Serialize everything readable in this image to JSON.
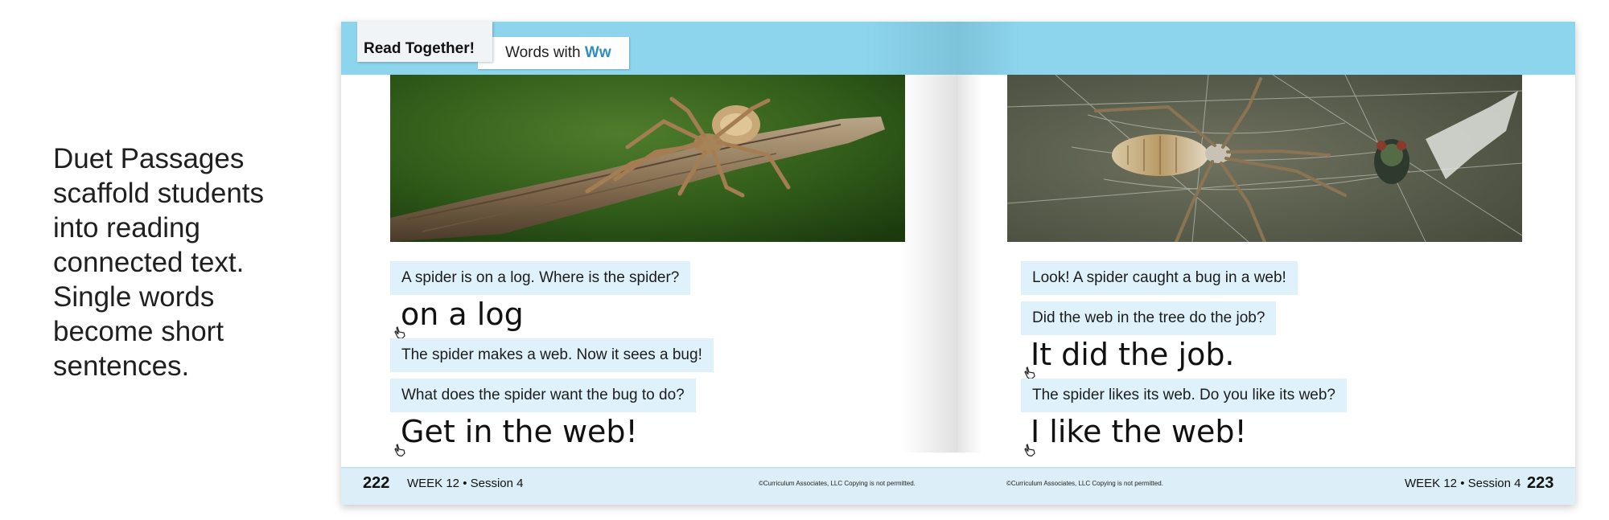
{
  "caption": {
    "lines": [
      "Duet Passages",
      "scaffold students",
      "into reading",
      "connected text.",
      "Single words",
      "become short",
      "sentences."
    ]
  },
  "header": {
    "read_together": "Read Together!",
    "words_with_prefix": "Words with ",
    "words_with_letter": "Ww"
  },
  "left_page": {
    "lines": [
      "A spider is on a log. Where is the spider?",
      "on a log",
      "The spider makes a web. Now it sees a bug!",
      "What does the spider want the bug to do?",
      "Get in the web!"
    ],
    "footer": {
      "page_number": "222",
      "week": "WEEK 12 • Session 4",
      "copyright": "©Curriculum Associates, LLC   Copying is not permitted."
    }
  },
  "right_page": {
    "lines": [
      "Look! A spider caught a bug in a web!",
      "Did the web in the tree do the job?",
      "It did the job.",
      "The spider likes its web. Do you like its web?",
      "I like the web!"
    ],
    "footer": {
      "page_number": "223",
      "week": "WEEK 12 • Session 4",
      "copyright": "©Curriculum Associates, LLC   Copying is not permitted."
    }
  },
  "icons": {
    "pointer": "pointing-hand-icon",
    "photo_left": "spider-on-log-photo",
    "photo_right": "spider-in-web-photo"
  },
  "colors": {
    "header_band": "#8dd5ec",
    "highlight": "#dff2fc",
    "accent_letter": "#2e8dc1",
    "footer": "#dceff8"
  }
}
